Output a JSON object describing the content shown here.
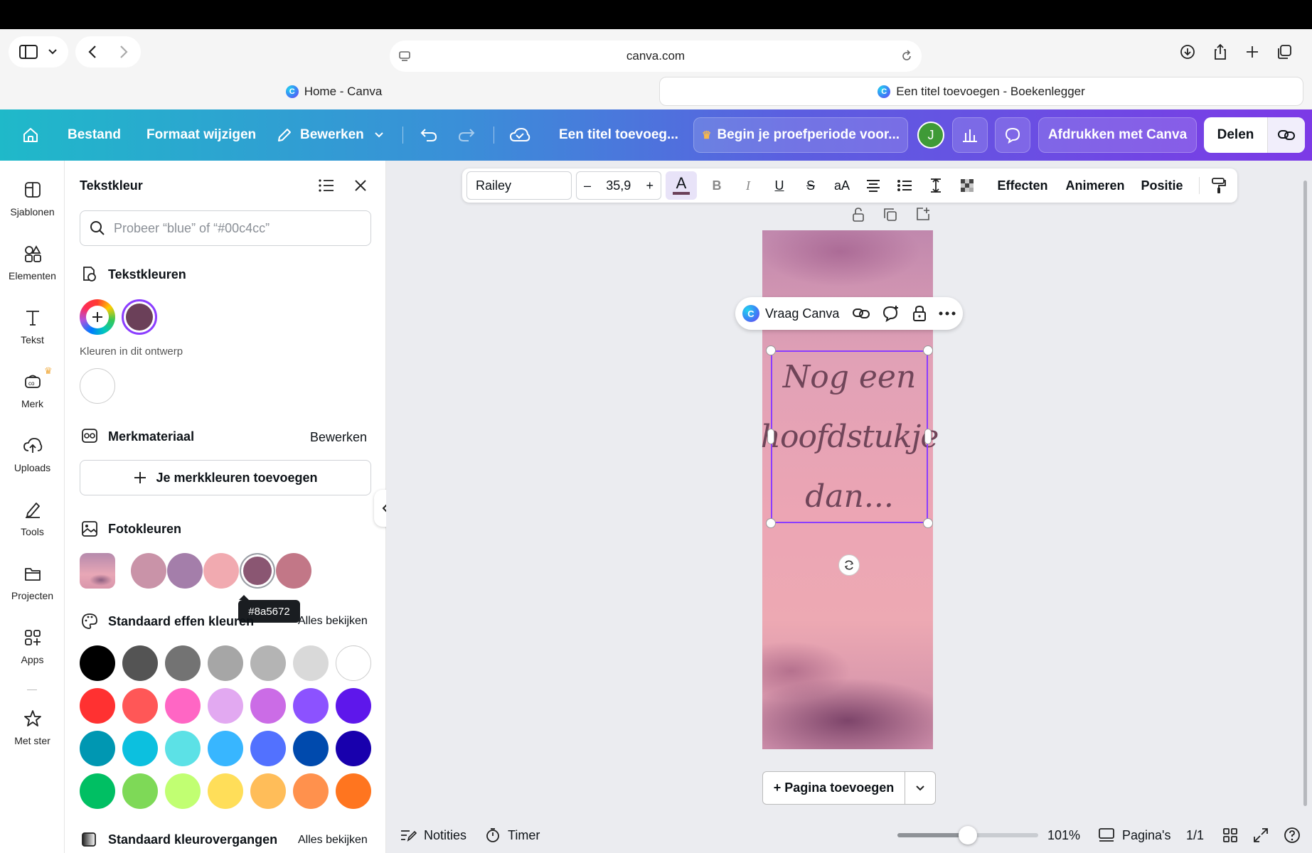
{
  "browser": {
    "url": "canva.com",
    "tabs": [
      {
        "label": "Home - Canva"
      },
      {
        "label": "Een titel toevoegen - Boekenlegger"
      }
    ]
  },
  "header": {
    "home_icon": "home-icon",
    "file": "Bestand",
    "resize": "Formaat wijzigen",
    "edit": "Bewerken",
    "title": "Een titel toevoeg...",
    "trial": "Begin je proefperiode voor...",
    "avatar_initial": "J",
    "print": "Afdrukken met Canva",
    "share": "Delen"
  },
  "rail": {
    "items": [
      {
        "label": "Sjablonen",
        "icon": "templates-icon"
      },
      {
        "label": "Elementen",
        "icon": "elements-icon"
      },
      {
        "label": "Tekst",
        "icon": "text-icon"
      },
      {
        "label": "Merk",
        "icon": "brand-icon"
      },
      {
        "label": "Uploads",
        "icon": "upload-icon"
      },
      {
        "label": "Tools",
        "icon": "tools-icon"
      },
      {
        "label": "Projecten",
        "icon": "folder-icon"
      },
      {
        "label": "Apps",
        "icon": "apps-icon"
      },
      {
        "label": "Met ster",
        "icon": "star-icon"
      }
    ]
  },
  "panel": {
    "title": "Tekstkleur",
    "search_placeholder": "Probeer “blue” of “#00c4cc”",
    "text_colors_title": "Tekstkleuren",
    "text_colors": [
      "#6b4059"
    ],
    "design_colors_label": "Kleuren in dit ontwerp",
    "design_colors": [
      "#ffffff"
    ],
    "brand_title": "Merkmateriaal",
    "brand_edit": "Bewerken",
    "brand_add": "Je merkkleuren toevoegen",
    "photo_title": "Fotokleuren",
    "photo_colors": [
      "#c993a8",
      "#a47eaa",
      "#f1aab0",
      "#8a5672",
      "#c27787"
    ],
    "tooltip": "#8a5672",
    "solid_title": "Standaard effen kleuren",
    "see_all": "Alles bekijken",
    "solid_colors": [
      "#000000",
      "#545454",
      "#737373",
      "#a6a6a6",
      "#b4b4b4",
      "#d9d9d9",
      "#ffffff",
      "#ff3131",
      "#ff5757",
      "#ff66c4",
      "#e2a9f1",
      "#cb6ce6",
      "#8c52ff",
      "#5e17eb",
      "#0097b2",
      "#0cc0df",
      "#5ce1e6",
      "#38b6ff",
      "#5271ff",
      "#004aad",
      "#1800ad",
      "#00bf63",
      "#7ed957",
      "#c1ff72",
      "#ffde59",
      "#ffbd59",
      "#ff914d",
      "#ff751f"
    ],
    "gradient_title": "Standaard kleurovergangen",
    "gradient_see_all": "Alles bekijken"
  },
  "toolbar": {
    "font": "Railey",
    "size": "35,9",
    "effects": "Effecten",
    "animate": "Animeren",
    "position": "Positie"
  },
  "floatbar": {
    "ask": "Vraag Canva"
  },
  "page": {
    "text_lines": [
      "Nog een",
      "hoofdstukje",
      "dan..."
    ]
  },
  "bottom": {
    "add_page": "+ Pagina toevoegen",
    "notes": "Notities",
    "timer": "Timer",
    "zoom": "101%",
    "zoom_level": 0.5,
    "pages": "Pagina's",
    "page_count": "1/1"
  }
}
